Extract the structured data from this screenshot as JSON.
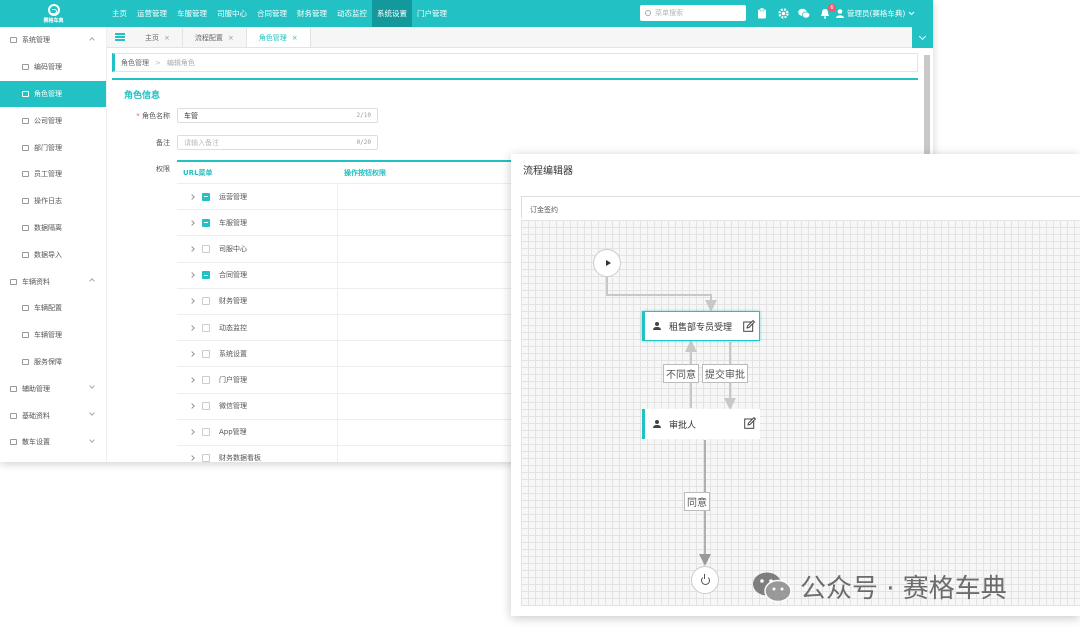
{
  "topbar": {
    "brand": "赛格车典",
    "nav": [
      "主页",
      "运营管理",
      "车服管理",
      "司服中心",
      "合同管理",
      "财务管理",
      "动态监控",
      "系统设置",
      "门户管理"
    ],
    "active_nav": "系统设置",
    "search_placeholder": "菜单搜索",
    "notification_count": "6",
    "user": "管理员(赛格车典)"
  },
  "sidebar": {
    "items": [
      {
        "label": "系统管理",
        "type": "group",
        "state": "up"
      },
      {
        "label": "编码管理",
        "type": "sub"
      },
      {
        "label": "角色管理",
        "type": "sub",
        "active": true
      },
      {
        "label": "公司管理",
        "type": "sub"
      },
      {
        "label": "部门管理",
        "type": "sub"
      },
      {
        "label": "员工管理",
        "type": "sub"
      },
      {
        "label": "操作日志",
        "type": "sub"
      },
      {
        "label": "数据隔离",
        "type": "sub"
      },
      {
        "label": "数据导入",
        "type": "sub"
      },
      {
        "label": "车辆资料",
        "type": "group",
        "state": "up"
      },
      {
        "label": "车辆配置",
        "type": "sub"
      },
      {
        "label": "车辆管理",
        "type": "sub"
      },
      {
        "label": "服务保障",
        "type": "sub"
      },
      {
        "label": "辅助管理",
        "type": "group",
        "state": "down"
      },
      {
        "label": "基础资料",
        "type": "group",
        "state": "down"
      },
      {
        "label": "散车设置",
        "type": "group",
        "state": "down"
      }
    ]
  },
  "tabs": [
    {
      "label": "主页",
      "close": "×"
    },
    {
      "label": "流程配置",
      "close": "×"
    },
    {
      "label": "角色管理",
      "close": "×",
      "active": true
    }
  ],
  "breadcrumb": {
    "parent": "角色管理",
    "sep": ">",
    "current": "编辑角色"
  },
  "form": {
    "section_title": "角色信息",
    "name_label": "角色名称",
    "name_value": "车管",
    "name_count": "2/10",
    "remark_label": "备注",
    "remark_placeholder": "请输入备注",
    "remark_count": "0/20",
    "perm_label": "权限"
  },
  "permissions": {
    "col1": "URL菜单",
    "col2": "操作按钮权限",
    "rows": [
      {
        "label": "运营管理",
        "checked": true
      },
      {
        "label": "车服管理",
        "checked": true
      },
      {
        "label": "司服中心",
        "checked": false
      },
      {
        "label": "合同管理",
        "checked": true
      },
      {
        "label": "财务管理",
        "checked": false
      },
      {
        "label": "动态监控",
        "checked": false
      },
      {
        "label": "系统设置",
        "checked": false
      },
      {
        "label": "门户管理",
        "checked": false
      },
      {
        "label": "微信管理",
        "checked": false
      },
      {
        "label": "App管理",
        "checked": false
      },
      {
        "label": "财务数据看板",
        "checked": false
      }
    ]
  },
  "flow_editor": {
    "title": "流程编辑器",
    "process_name": "订金签约",
    "nodes": {
      "task1": "租售部专员受理",
      "task2": "审批人"
    },
    "edges": {
      "reject": "不同意",
      "submit": "提交审批",
      "agree": "同意"
    }
  },
  "watermark": "公众号 · 赛格车典",
  "colors": {
    "accent": "#22c1c3",
    "accent_dark": "#13999b"
  }
}
